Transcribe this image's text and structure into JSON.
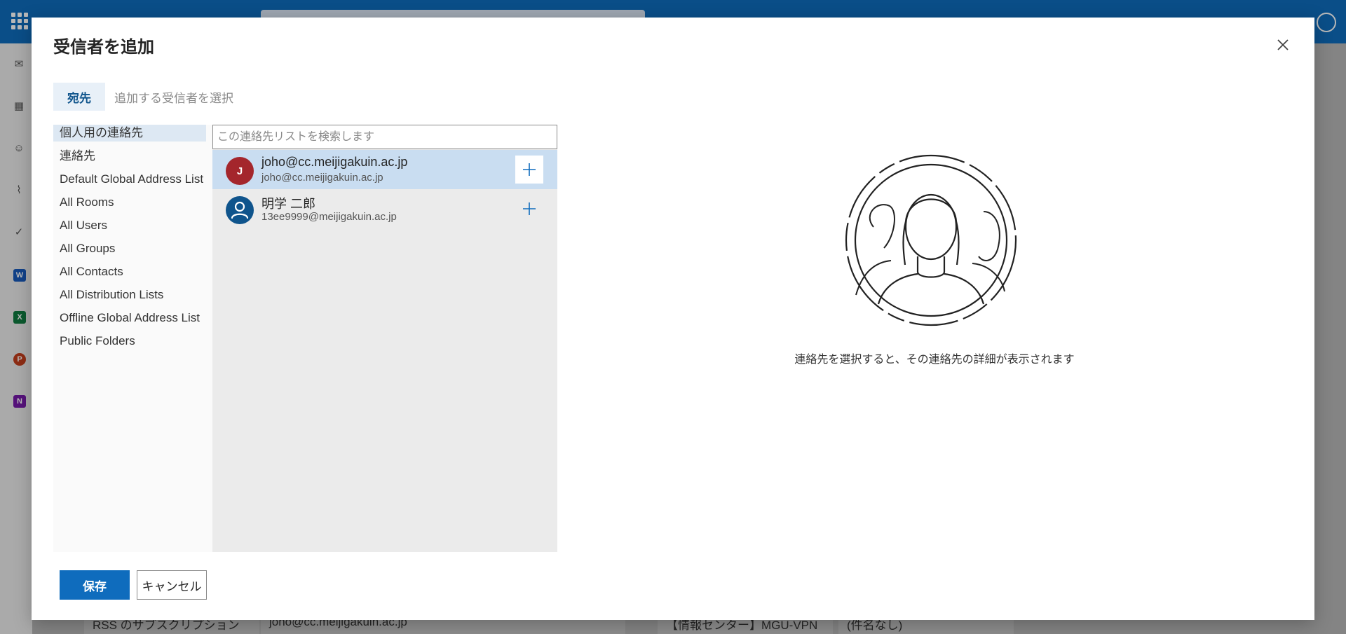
{
  "background": {
    "bottom_items": [
      "RSS のサブスクリプション",
      "joho@cc.meijigakuin.ac.jp",
      "【情報センター】MGU-VPN利...",
      "(件名なし)"
    ]
  },
  "dialog": {
    "title": "受信者を追加",
    "to_label": "宛先",
    "to_placeholder": "追加する受信者を選択",
    "sources": [
      "個人用の連絡先",
      "連絡先",
      "Default Global Address List",
      "All Rooms",
      "All Users",
      "All Groups",
      "All Contacts",
      "All Distribution Lists",
      "Offline Global Address List",
      "Public Folders"
    ],
    "search_placeholder": "この連絡先リストを検索します",
    "contacts": [
      {
        "initial": "J",
        "name": "joho@cc.meijigakuin.ac.jp",
        "email": "joho@cc.meijigakuin.ac.jp",
        "avatar_color": "#a4262c"
      },
      {
        "initial": "",
        "name": "明学 二郎",
        "email": "13ee9999@meijigakuin.ac.jp",
        "avatar_color": "#0f548c"
      }
    ],
    "detail_message": "連絡先を選択すると、その連絡先の詳細が表示されます",
    "save_label": "保存",
    "cancel_label": "キャンセル"
  },
  "colors": {
    "accent": "#0f6cbd",
    "selected_row": "#c9ddf1"
  }
}
